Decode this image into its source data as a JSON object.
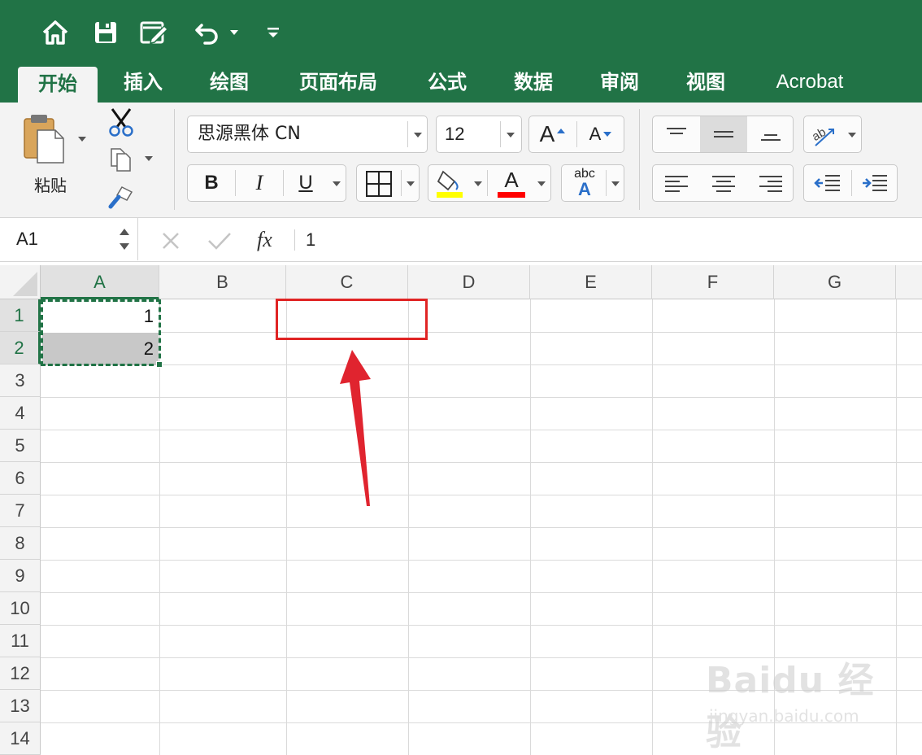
{
  "quick_access": {
    "icons": [
      "home-icon",
      "save-icon",
      "edit-icon",
      "undo-icon",
      "customize-icon"
    ]
  },
  "tabs": [
    {
      "label": "开始",
      "active": true
    },
    {
      "label": "插入"
    },
    {
      "label": "绘图"
    },
    {
      "label": "页面布局"
    },
    {
      "label": "公式"
    },
    {
      "label": "数据"
    },
    {
      "label": "审阅"
    },
    {
      "label": "视图"
    },
    {
      "label": "Acrobat"
    }
  ],
  "ribbon": {
    "paste_label": "粘贴",
    "font_name": "思源黑体 CN",
    "font_size": "12",
    "grow_font": "A",
    "shrink_font": "A",
    "bold": "B",
    "italic": "I",
    "underline": "U",
    "font_color_letter": "A",
    "phonetic_top": "abc",
    "phonetic_bottom": "A",
    "fill_color": "#ffff00",
    "font_color": "#ff0000"
  },
  "formula_bar": {
    "name_box": "A1",
    "fx": "fx",
    "value": "1"
  },
  "sheet": {
    "columns": [
      "A",
      "B",
      "C",
      "D",
      "E",
      "F",
      "G"
    ],
    "rows": [
      "1",
      "2",
      "3",
      "4",
      "5",
      "6",
      "7",
      "8",
      "9",
      "10",
      "11",
      "12",
      "13",
      "14"
    ],
    "cells": {
      "A1": "1",
      "A2": "2"
    },
    "selected_range": "A1:A2"
  },
  "watermark": {
    "brand": "Baidu 经验",
    "url": "jingyan.baidu.com"
  },
  "colors": {
    "excel_green": "#217346",
    "annotation_red": "#e02424"
  }
}
